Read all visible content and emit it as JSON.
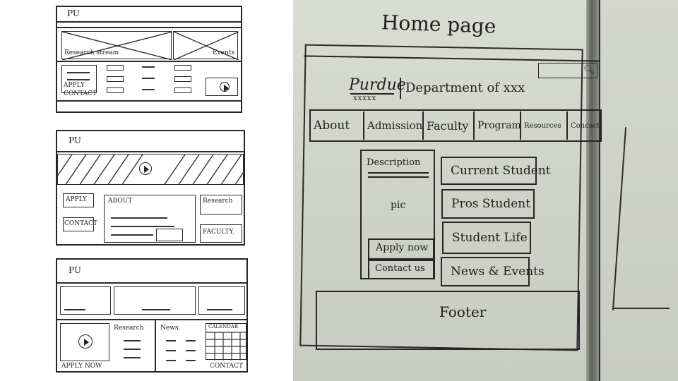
{
  "left_sketches": {
    "sketch1": {
      "logo": "PU",
      "research_label": "Research stream",
      "events_label": "Events",
      "apply_label": "APPLY",
      "contact_label": "CONTACT"
    },
    "sketch2": {
      "logo": "PU",
      "apply_label": "APPLY",
      "contact_label": "CONTACT",
      "about_label": "ABOUT",
      "research_label": "Research",
      "faculty_label": "FACULTY."
    },
    "sketch3": {
      "logo": "PU",
      "research_label": "Research",
      "news_label": "News.",
      "calendar_label": "CALENDAR",
      "apply_label": "APPLY NOW",
      "contact_label": "CONTACT"
    }
  },
  "whiteboard": {
    "title": "Home page",
    "search_icon": "search-icon",
    "logo": "Purdue",
    "logo_sub": "xxxxx",
    "department": "Department of xxx",
    "nav": [
      {
        "label": "About"
      },
      {
        "label": "Admission"
      },
      {
        "label": "Faculty"
      },
      {
        "label": "Program"
      },
      {
        "label": "Resources"
      },
      {
        "label": "Concact"
      }
    ],
    "description_label": "Description",
    "pic_label": "pic",
    "apply_label": "Apply now",
    "contact_label": "Contact us",
    "cards": [
      {
        "label": "Current Student"
      },
      {
        "label": "Pros Student"
      },
      {
        "label": "Student Life"
      },
      {
        "label": "News & Events"
      }
    ],
    "footer_label": "Footer"
  },
  "colors": {
    "ink": "#1e1e1e",
    "whiteboard": "#d2d6cc",
    "paper": "#ffffff"
  }
}
